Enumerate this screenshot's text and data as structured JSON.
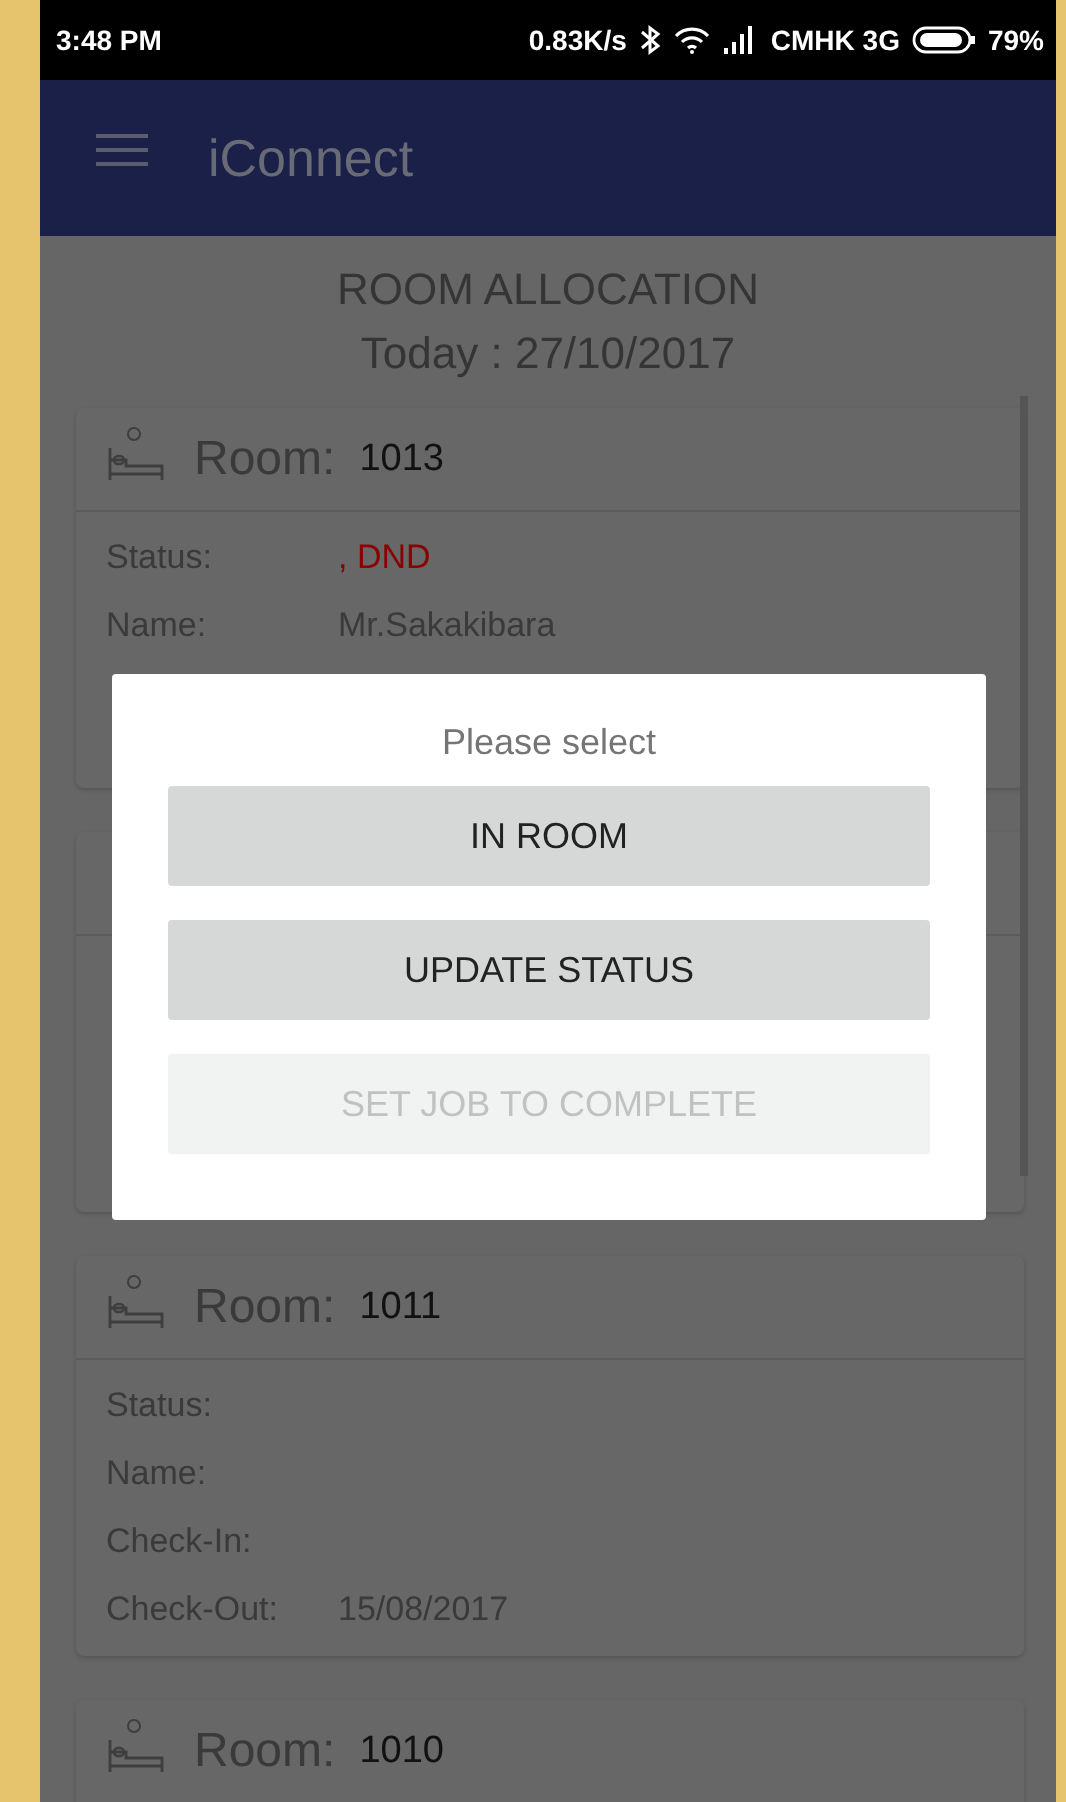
{
  "status_bar": {
    "time": "3:48 PM",
    "speed": "0.83K/s",
    "carrier": "CMHK 3G",
    "battery": "79%"
  },
  "app_bar": {
    "title": "iConnect"
  },
  "heading": {
    "title": "ROOM ALLOCATION",
    "date": "Today : 27/10/2017"
  },
  "rooms": [
    {
      "kind": "room",
      "label": "Room:",
      "number": "1013",
      "rows": [
        {
          "label": "Status:",
          "value": ", DND",
          "alert": true
        },
        {
          "label": "Name:",
          "value": "Mr.Sakakibara",
          "alert": false
        }
      ]
    },
    {
      "kind": "room"
    },
    {
      "kind": "room",
      "label": "Room:",
      "number": "1011",
      "rows": [
        {
          "label": "Status:"
        },
        {
          "label": "Name:"
        },
        {
          "label": "Check-In:"
        },
        {
          "label": "Check-Out:",
          "value": "15/08/2017",
          "alert": false
        }
      ]
    },
    {
      "kind": "room",
      "label": "Room:",
      "number": "1010"
    }
  ],
  "dialog": {
    "title": "Please select",
    "buttons": [
      {
        "label": "IN ROOM",
        "disabled": false
      },
      {
        "label": "UPDATE STATUS",
        "disabled": false
      },
      {
        "label": "SET JOB TO COMPLETE",
        "disabled": true
      }
    ]
  }
}
